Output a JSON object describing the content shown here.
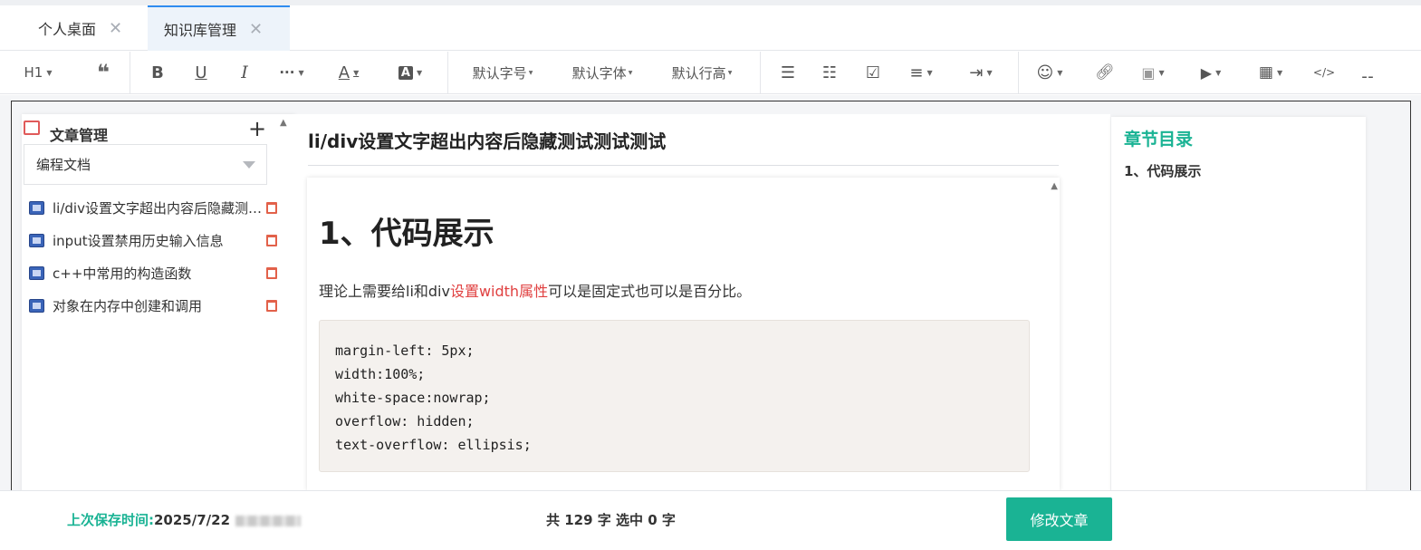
{
  "tabs": [
    {
      "label": "个人桌面",
      "active": false
    },
    {
      "label": "知识库管理",
      "active": true
    }
  ],
  "toolbar": {
    "heading": "H1",
    "quote": "❝",
    "bold": "B",
    "underline": "U",
    "italic": "I",
    "more": "···",
    "font_color": "A",
    "bg_color": "A",
    "font_size": "默认字号",
    "font_family": "默认字体",
    "line_height": "默认行高",
    "icons": [
      "bulleted-list-icon",
      "numbered-list-icon",
      "todo-checkbox-icon",
      "align-icon",
      "indent-icon",
      "emoji-icon",
      "link-icon",
      "image-icon",
      "video-icon",
      "table-icon",
      "code-icon",
      "divider-icon"
    ]
  },
  "sidebar": {
    "title": "文章管理",
    "add_symbol": "+",
    "category": "编程文档",
    "items": [
      {
        "label": "li/div设置文字超出内容后隐藏测试测试测试"
      },
      {
        "label": "input设置禁用历史输入信息"
      },
      {
        "label": "c++中常用的构造函数"
      },
      {
        "label": "对象在内存中创建和调用"
      }
    ]
  },
  "article": {
    "title": "li/div设置文字超出内容后隐藏测试测试测试",
    "heading": "1、代码展示",
    "para_before": "理论上需要给li和div",
    "para_highlight": "设置width属性",
    "para_after": "可以是固定式也可以是百分比。",
    "code": "margin-left: 5px;\nwidth:100%;\nwhite-space:nowrap;\noverflow: hidden;\ntext-overflow: ellipsis;"
  },
  "toc": {
    "title": "章节目录",
    "items": [
      "1、代码展示"
    ]
  },
  "footer": {
    "save_label": "上次保存时间:",
    "save_date": "2025/7/22",
    "count_text": "共 129 字 选中 0 字",
    "edit_button": "修改文章"
  },
  "colors": {
    "accent": "#1ab394",
    "highlight": "#e04040",
    "active_tab_border": "#2f8cf0"
  }
}
